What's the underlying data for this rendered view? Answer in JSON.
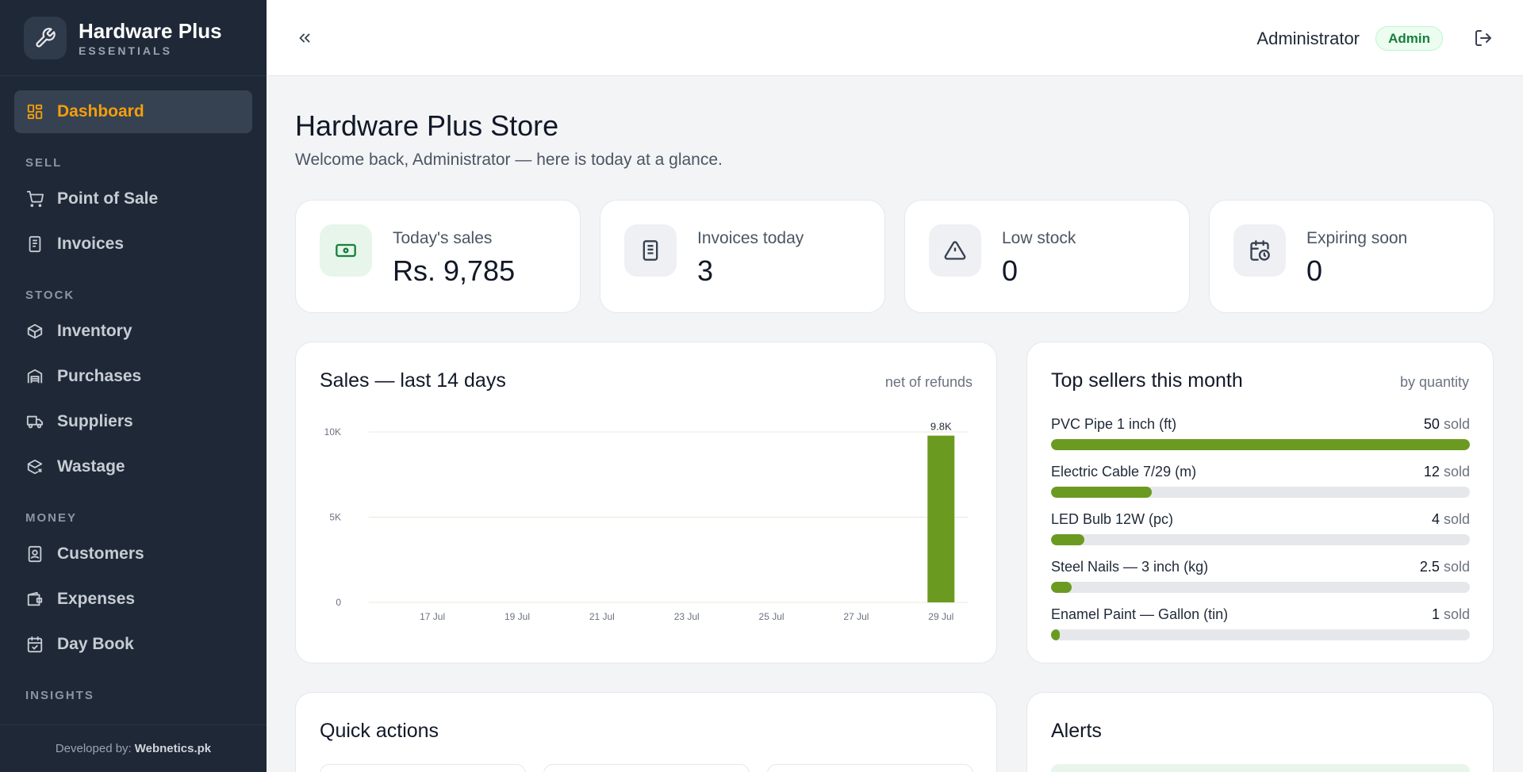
{
  "brand": {
    "title": "Hardware Plus",
    "subtitle": "ESSENTIALS"
  },
  "sidebar": {
    "active": {
      "label": "Dashboard",
      "icon": "dashboard-icon"
    },
    "sections": [
      {
        "label": "SELL",
        "items": [
          {
            "label": "Point of Sale",
            "icon": "cart-icon"
          },
          {
            "label": "Invoices",
            "icon": "invoice-icon"
          }
        ]
      },
      {
        "label": "STOCK",
        "items": [
          {
            "label": "Inventory",
            "icon": "box-icon"
          },
          {
            "label": "Purchases",
            "icon": "warehouse-icon"
          },
          {
            "label": "Suppliers",
            "icon": "truck-icon"
          },
          {
            "label": "Wastage",
            "icon": "box-x-icon"
          }
        ]
      },
      {
        "label": "MONEY",
        "items": [
          {
            "label": "Customers",
            "icon": "contact-icon"
          },
          {
            "label": "Expenses",
            "icon": "wallet-icon"
          },
          {
            "label": "Day Book",
            "icon": "calendar-check-icon"
          }
        ]
      },
      {
        "label": "INSIGHTS",
        "items": []
      }
    ],
    "footer": {
      "prefix": "Developed by:",
      "company": "Webnetics.pk"
    }
  },
  "topbar": {
    "user": "Administrator",
    "role": "Admin"
  },
  "page": {
    "title": "Hardware Plus Store",
    "subtitle": "Welcome back, Administrator — here is today at a glance."
  },
  "stats": [
    {
      "label": "Today's sales",
      "value": "Rs. 9,785",
      "icon": "cash-icon"
    },
    {
      "label": "Invoices today",
      "value": "3",
      "icon": "receipt-icon"
    },
    {
      "label": "Low stock",
      "value": "0",
      "icon": "warning-icon"
    },
    {
      "label": "Expiring soon",
      "value": "0",
      "icon": "calendar-clock-icon"
    }
  ],
  "sales_panel": {
    "title": "Sales — last 14 days",
    "note": "net of refunds"
  },
  "chart_data": {
    "type": "bar",
    "categories": [
      "16 Jul",
      "17 Jul",
      "18 Jul",
      "19 Jul",
      "20 Jul",
      "21 Jul",
      "22 Jul",
      "23 Jul",
      "24 Jul",
      "25 Jul",
      "26 Jul",
      "27 Jul",
      "28 Jul",
      "29 Jul"
    ],
    "tick_labels": [
      "17 Jul",
      "19 Jul",
      "21 Jul",
      "23 Jul",
      "25 Jul",
      "27 Jul",
      "29 Jul"
    ],
    "values": [
      0,
      0,
      0,
      0,
      0,
      0,
      0,
      0,
      0,
      0,
      0,
      0,
      0,
      9785
    ],
    "data_labels": {
      "29 Jul": "9.8K"
    },
    "y_ticks": [
      {
        "value": 0,
        "label": "0"
      },
      {
        "value": 5000,
        "label": "5K"
      },
      {
        "value": 10000,
        "label": "10K"
      }
    ],
    "ylim": [
      0,
      10000
    ],
    "color": "#6b9a21",
    "grid": true,
    "title": "",
    "xlabel": "",
    "ylabel": ""
  },
  "top_sellers": {
    "title": "Top sellers this month",
    "note": "by quantity",
    "sold_suffix": "sold",
    "items": [
      {
        "name": "PVC Pipe 1 inch (ft)",
        "qty": "50",
        "fraction": 1.0
      },
      {
        "name": "Electric Cable 7/29 (m)",
        "qty": "12",
        "fraction": 0.24
      },
      {
        "name": "LED Bulb 12W (pc)",
        "qty": "4",
        "fraction": 0.08
      },
      {
        "name": "Steel Nails — 3 inch (kg)",
        "qty": "2.5",
        "fraction": 0.05
      },
      {
        "name": "Enamel Paint — Gallon (tin)",
        "qty": "1",
        "fraction": 0.02
      }
    ]
  },
  "quick_actions": {
    "title": "Quick actions"
  },
  "alerts": {
    "title": "Alerts"
  }
}
